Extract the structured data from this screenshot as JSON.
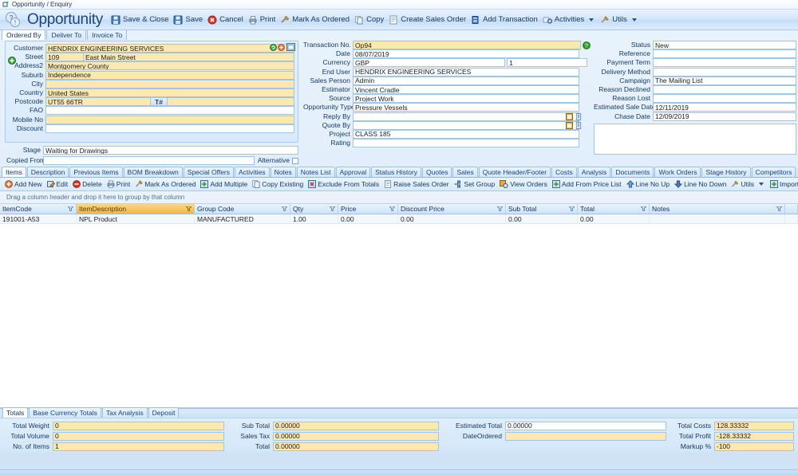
{
  "window": {
    "title": "Opportunity / Enquiry",
    "icon": "window-icon"
  },
  "header": {
    "title": "Opportunity",
    "help_icon": "help-question-icon",
    "toolbar": [
      {
        "label": "Save & Close",
        "icon": "save-close-icon"
      },
      {
        "label": "Save",
        "icon": "save-icon"
      },
      {
        "label": "Cancel",
        "icon": "cancel-icon"
      },
      {
        "label": "Print",
        "icon": "print-icon"
      },
      {
        "label": "Mark As Ordered",
        "icon": "mark-as-ordered-icon"
      },
      {
        "label": "Copy",
        "icon": "copy-icon"
      },
      {
        "label": "Create Sales Order",
        "icon": "create-sales-order-icon"
      },
      {
        "label": "Add Transaction",
        "icon": "add-transaction-icon"
      },
      {
        "label": "Activities",
        "icon": "activities-icon",
        "dropdown": true
      },
      {
        "label": "Utils",
        "icon": "utils-icon",
        "dropdown": true
      }
    ]
  },
  "address_tabs": [
    {
      "label": "Ordered By",
      "active": true
    },
    {
      "label": "Deliver To",
      "active": false
    },
    {
      "label": "Invoice To",
      "active": false
    }
  ],
  "left_form": {
    "customer": {
      "label": "Customer",
      "value": "HENDRIX ENGINEERING SERVICES"
    },
    "street_no": {
      "label": "Street",
      "value": "109"
    },
    "street_name": {
      "value": "East Main Street"
    },
    "address2": {
      "label": "Address2",
      "value": "Montgomery County"
    },
    "suburb": {
      "label": "Suburb",
      "value": "Independence"
    },
    "city": {
      "label": "City",
      "value": ""
    },
    "country": {
      "label": "Country",
      "value": "United States"
    },
    "postcode": {
      "label": "Postcode",
      "value": "UT55 66TR"
    },
    "tel_button": {
      "label": "T#"
    },
    "tel_value": {
      "value": ""
    },
    "fao": {
      "label": "FAO",
      "value": ""
    },
    "mobile_no": {
      "label": "Mobile No",
      "value": ""
    },
    "discount": {
      "label": "Discount",
      "value": ""
    },
    "stage": {
      "label": "Stage",
      "value": "Waiting for Drawings"
    },
    "copied_from": {
      "label": "Copied From",
      "value": ""
    },
    "alternative": {
      "label": "Alternative",
      "checked": false
    },
    "icons": {
      "refresh": "refresh-customer-icon",
      "add": "add-customer-icon",
      "open": "open-customer-icon",
      "expand": "expand-address-icon"
    }
  },
  "mid_form": {
    "transaction_no": {
      "label": "Transaction No.",
      "value": "Op94"
    },
    "date": {
      "label": "Date",
      "value": "08/07/2019"
    },
    "currency": {
      "label": "Currency",
      "value": "GBP"
    },
    "currency_rate": {
      "value": "1"
    },
    "end_user": {
      "label": "End User",
      "value": "HENDRIX ENGINEERING SERVICES"
    },
    "sales_person": {
      "label": "Sales Person",
      "value": "Admin"
    },
    "estimator": {
      "label": "Estimator",
      "value": "Vincent Cradle"
    },
    "source": {
      "label": "Source",
      "value": "Project Work"
    },
    "opportunity_type": {
      "label": "Opportunity Type",
      "value": "Pressure Vessels"
    },
    "reply_by": {
      "label": "Reply By",
      "value": ""
    },
    "quote_by": {
      "label": "Quote By",
      "value": ""
    },
    "project": {
      "label": "Project",
      "value": "CLASS 185"
    },
    "rating": {
      "label": "Rating",
      "value": ""
    },
    "icons": {
      "help": "help-icon",
      "calendar": "calendar-icon",
      "clear": "clear-date-icon"
    }
  },
  "right_form": {
    "status": {
      "label": "Status",
      "value": "New"
    },
    "reference": {
      "label": "Reference",
      "value": ""
    },
    "payment_term": {
      "label": "Payment Term",
      "value": ""
    },
    "delivery_method": {
      "label": "Delivery Method",
      "value": ""
    },
    "campaign": {
      "label": "Campaign",
      "value": "The Mailing List"
    },
    "reason_declined": {
      "label": "Reason Declined",
      "value": ""
    },
    "reason_lost": {
      "label": "Reason Lost",
      "value": ""
    },
    "estimated_sale_date": {
      "label": "Estimated Sale Date",
      "value": "12/11/2019"
    },
    "chase_date": {
      "label": "Chase Date",
      "value": "12/09/2019"
    },
    "notes_area": {
      "value": ""
    }
  },
  "section_tabs": [
    {
      "label": "Items",
      "active": true
    },
    {
      "label": "Description",
      "active": false
    },
    {
      "label": "Previous Items",
      "active": false
    },
    {
      "label": "BOM Breakdown",
      "active": false
    },
    {
      "label": "Special Offers",
      "active": false
    },
    {
      "label": "Activities",
      "active": false
    },
    {
      "label": "Notes",
      "active": false
    },
    {
      "label": "Notes List",
      "active": false
    },
    {
      "label": "Approval",
      "active": false
    },
    {
      "label": "Status History",
      "active": false
    },
    {
      "label": "Quotes",
      "active": false
    },
    {
      "label": "Sales",
      "active": false
    },
    {
      "label": "Quote Header/Footer",
      "active": false
    },
    {
      "label": "Costs",
      "active": false
    },
    {
      "label": "Analysis",
      "active": false
    },
    {
      "label": "Documents",
      "active": false
    },
    {
      "label": "Work Orders",
      "active": false
    },
    {
      "label": "Stage History",
      "active": false
    },
    {
      "label": "Competitors",
      "active": false
    }
  ],
  "grid_toolbar": [
    {
      "label": "Add New",
      "icon": "add-new-icon"
    },
    {
      "label": "Edit",
      "icon": "edit-icon"
    },
    {
      "label": "Delete",
      "icon": "delete-icon"
    },
    {
      "label": "Print",
      "icon": "print-icon"
    },
    {
      "label": "Mark As Ordered",
      "icon": "mark-as-ordered-icon"
    },
    {
      "label": "Add Multiple",
      "icon": "add-multiple-icon"
    },
    {
      "label": "Copy Existing",
      "icon": "copy-existing-icon"
    },
    {
      "label": "Exclude From Totals",
      "icon": "exclude-from-totals-icon"
    },
    {
      "label": "Raise Sales Order",
      "icon": "raise-sales-order-icon"
    },
    {
      "label": "Set Group",
      "icon": "set-group-icon"
    },
    {
      "label": "View Orders",
      "icon": "view-orders-icon"
    },
    {
      "label": "Add From Price List",
      "icon": "add-from-price-list-icon"
    },
    {
      "label": "Line No Up",
      "icon": "line-no-up-icon"
    },
    {
      "label": "Line No Down",
      "icon": "line-no-down-icon"
    },
    {
      "label": "Utils",
      "icon": "utils-icon",
      "dropdown": true
    },
    {
      "label": "Import Items",
      "icon": "import-items-icon"
    }
  ],
  "grid": {
    "group_hint": "Drag a column header and drop it here to group by that column",
    "columns": [
      {
        "label": "ItemCode",
        "width": 96,
        "sorted": false
      },
      {
        "label": "ItemDescription",
        "width": 148,
        "sorted": true
      },
      {
        "label": "Group Code",
        "width": 120,
        "sorted": false
      },
      {
        "label": "Qty",
        "width": 60,
        "sorted": false
      },
      {
        "label": "Price",
        "width": 75,
        "sorted": false
      },
      {
        "label": "Discount Price",
        "width": 135,
        "sorted": false
      },
      {
        "label": "Sub Total",
        "width": 90,
        "sorted": false
      },
      {
        "label": "Total",
        "width": 90,
        "sorted": false
      },
      {
        "label": "Notes",
        "width": 170,
        "sorted": false
      }
    ],
    "rows": [
      {
        "ItemCode": "191001-A53",
        "ItemDescription": "NPL Product",
        "Group Code": "MANUFACTURED",
        "Qty": "1.00",
        "Price": "0.00",
        "Discount Price": "0.00",
        "Sub Total": "0.00",
        "Total": "0.00",
        "Notes": ""
      }
    ]
  },
  "bottom_tabs": [
    {
      "label": "Totals",
      "active": true
    },
    {
      "label": "Base Currency Totals",
      "active": false
    },
    {
      "label": "Tax Analysis",
      "active": false
    },
    {
      "label": "Deposit",
      "active": false
    }
  ],
  "totals": {
    "total_weight": {
      "label": "Total Weight",
      "value": "0"
    },
    "total_volume": {
      "label": "Total Volume",
      "value": "0"
    },
    "no_of_items": {
      "label": "No. of Items",
      "value": "1"
    },
    "sub_total": {
      "label": "Sub Total",
      "value": "0.00000"
    },
    "sales_tax": {
      "label": "Sales Tax",
      "value": "0.00000"
    },
    "total": {
      "label": "Total",
      "value": "0.00000"
    },
    "estimated_total": {
      "label": "Estimated Total",
      "value": "0.00000"
    },
    "date_ordered": {
      "label": "DateOrdered",
      "value": ""
    },
    "total_costs": {
      "label": "Total Costs",
      "value": "128.33332"
    },
    "total_profit": {
      "label": "Total Profit",
      "value": "-128.33332"
    },
    "markup_pct": {
      "label": "Markup %",
      "value": "-100"
    }
  },
  "colors": {
    "accent": "#19467f",
    "field_yellow": "#fde9b0",
    "sorted_header": "#f6b63f",
    "panel_border": "#a8cbea"
  }
}
